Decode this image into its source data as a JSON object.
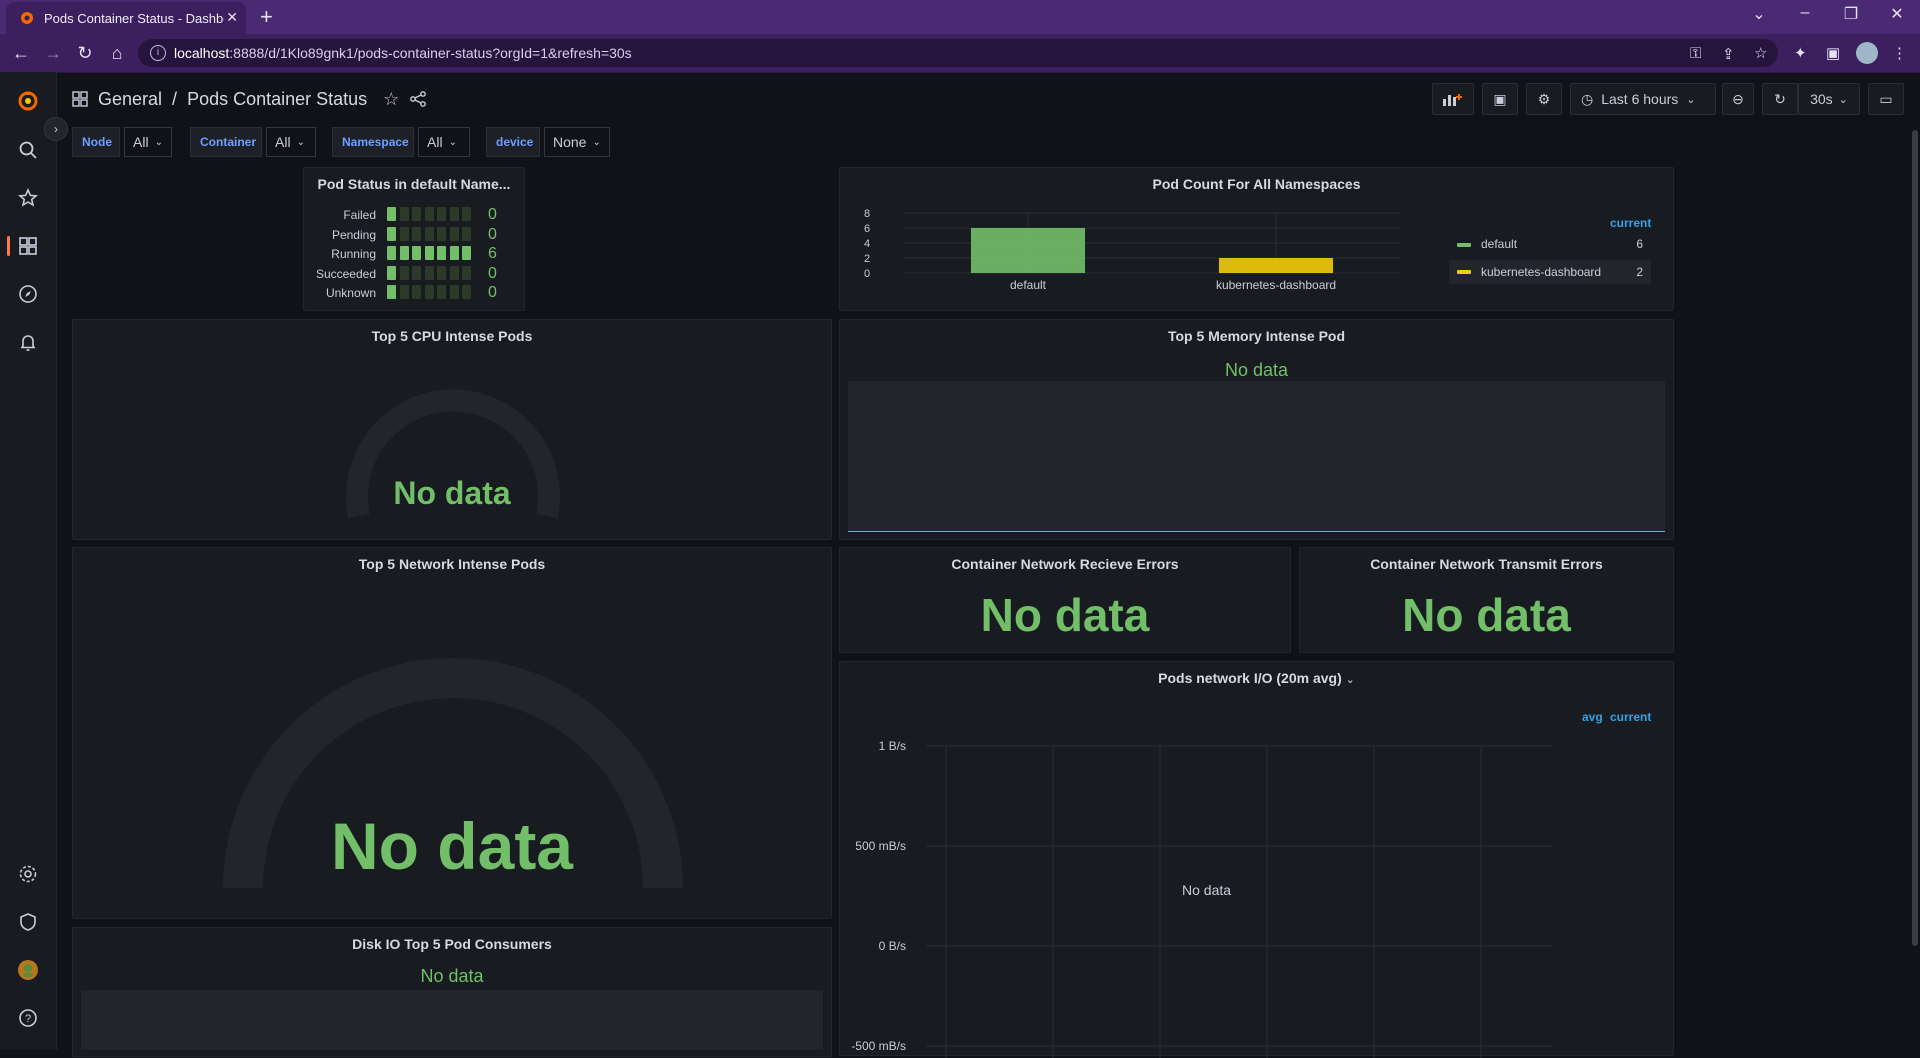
{
  "browser": {
    "tab_title": "Pods Container Status - Dashboard",
    "new_tab": "+",
    "url_host": "localhost",
    "url_rest": ":8888/d/1Klo89gnk1/pods-container-status?orgId=1&refresh=30s"
  },
  "sidemenu": {
    "items": [
      "grafana-logo-icon",
      "search-icon",
      "star-icon",
      "dashboards-icon",
      "explore-icon",
      "alerting-icon",
      "settings-icon",
      "shield-icon",
      "avatar",
      "help-icon"
    ]
  },
  "header": {
    "breadcrumb_folder": "General",
    "breadcrumb_sep": "/",
    "breadcrumb_title": "Pods Container Status",
    "time_range": "Last 6 hours",
    "refresh_interval": "30s"
  },
  "variables": [
    {
      "label": "Node",
      "value": "All"
    },
    {
      "label": "Container",
      "value": "All"
    },
    {
      "label": "Namespace",
      "value": "All"
    },
    {
      "label": "device",
      "value": "None"
    }
  ],
  "panels": {
    "pod_status": {
      "title": "Pod Status in default Name...",
      "rows": [
        {
          "label": "Failed",
          "value": "0",
          "lit": 1
        },
        {
          "label": "Pending",
          "value": "0",
          "lit": 1
        },
        {
          "label": "Running",
          "value": "6",
          "lit": 7
        },
        {
          "label": "Succeeded",
          "value": "0",
          "lit": 1
        },
        {
          "label": "Unknown",
          "value": "0",
          "lit": 1
        }
      ]
    },
    "pod_count": {
      "title": "Pod Count For All Namespaces",
      "legend_header": "current",
      "legend": [
        {
          "name": "default",
          "value": "6",
          "color": "#73bf69"
        },
        {
          "name": "kubernetes-dashboard",
          "value": "2",
          "color": "#f2cc0c"
        }
      ]
    },
    "cpu": {
      "title": "Top 5 CPU Intense Pods",
      "no_data": "No data"
    },
    "memory": {
      "title": "Top 5 Memory Intense Pod",
      "no_data": "No data"
    },
    "network": {
      "title": "Top 5 Network Intense Pods",
      "no_data": "No data"
    },
    "recv_errors": {
      "title": "Container Network Recieve Errors",
      "no_data": "No data"
    },
    "transmit_errors": {
      "title": "Container Network Transmit Errors",
      "no_data": "No data"
    },
    "network_io": {
      "title": "Pods network I/O (20m avg)",
      "legend_avg": "avg",
      "legend_current": "current",
      "no_data": "No data",
      "y_ticks": [
        "1 B/s",
        "500 mB/s",
        "0 B/s",
        "-500 mB/s"
      ]
    },
    "disk_io": {
      "title": "Disk IO Top 5 Pod Consumers",
      "no_data": "No data"
    }
  },
  "chart_data": {
    "type": "bar",
    "title": "Pod Count For All Namespaces",
    "categories": [
      "default",
      "kubernetes-dashboard"
    ],
    "values": [
      6,
      2
    ],
    "colors": [
      "#73bf69",
      "#f2cc0c"
    ],
    "y_ticks": [
      0,
      2,
      4,
      6,
      8
    ],
    "ylim": [
      0,
      8
    ],
    "grid": true,
    "legend_placement": "right"
  },
  "colors": {
    "accent_green": "#73bf69",
    "accent_yellow": "#f2cc0c",
    "link_blue": "#6e9fff",
    "legend_blue": "#33a2e5"
  }
}
